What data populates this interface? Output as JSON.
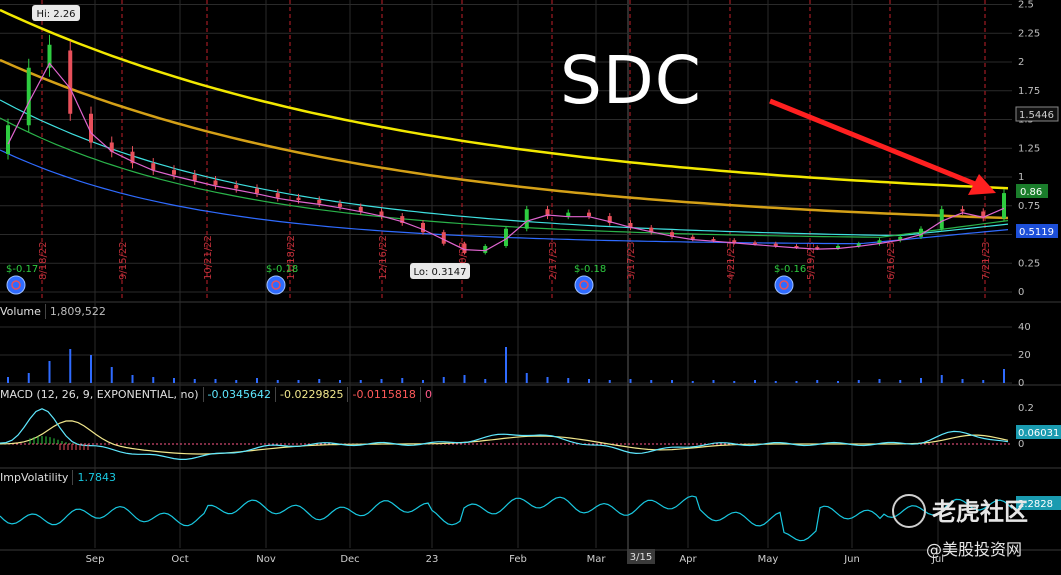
{
  "chart_title": "SDC",
  "colors": {
    "background": "#000000",
    "grid": "#2a2a2a",
    "candle_up": "#2ecc40",
    "candle_down": "#e8505b",
    "ma_yellow": "#f2e800",
    "ma_gold": "#d4a017",
    "ma_cyan": "#3fe0e0",
    "ma_green": "#2ab34a",
    "ma_blue": "#2f6bff",
    "ma_pink": "#e065d0",
    "ma_white": "#e8e8e8",
    "volume_bar": "#2f6bff",
    "macd_line": "#5fe8ff",
    "macd_signal": "#f0e68c",
    "macd_zero": "#ff5a8a",
    "iv_line": "#19c8e0",
    "arrow": "#ff2020"
  },
  "chart_data": [
    {
      "type": "candlestick",
      "pane": "price",
      "x_labels": [
        "Sep",
        "Oct",
        "Nov",
        "Dec",
        "23",
        "Feb",
        "Mar",
        "Apr",
        "May",
        "Jun",
        "Jul"
      ],
      "cursor_label": "3/15",
      "ylim": [
        0,
        2.5
      ],
      "y_ticks": [
        "2.5",
        "2.25",
        "2",
        "1.75",
        "1.5",
        "1.25",
        "1",
        "0.75",
        "0.5",
        "0.25",
        "0"
      ],
      "hi_label": "Hi: 2.26",
      "lo_label": "Lo: 0.3147",
      "last_price_label": "0.86",
      "level_labels": [
        "1.5446",
        "0.5119"
      ],
      "dividends": [
        "$-0.17",
        "$-0.18",
        "$-0.18",
        "$-0.16"
      ],
      "date_markers": [
        "8/18/22",
        "9/15/22",
        "10/21/22",
        "11/18/22",
        "12/16/22",
        "1/20/23",
        "2/17/23",
        "3/17/23",
        "4/21/23",
        "5/19/23",
        "6/16/23",
        "7/21/23"
      ],
      "candles_approx": [
        [
          1.2,
          1.45
        ],
        [
          1.45,
          1.95
        ],
        [
          1.95,
          2.15
        ],
        [
          2.1,
          1.55
        ],
        [
          1.55,
          1.3
        ],
        [
          1.3,
          1.22
        ],
        [
          1.22,
          1.12
        ],
        [
          1.12,
          1.06
        ],
        [
          1.06,
          1.02
        ],
        [
          1.02,
          0.97
        ],
        [
          0.97,
          0.93
        ],
        [
          0.93,
          0.9
        ],
        [
          0.9,
          0.86
        ],
        [
          0.86,
          0.82
        ],
        [
          0.82,
          0.8
        ],
        [
          0.8,
          0.77
        ],
        [
          0.77,
          0.74
        ],
        [
          0.74,
          0.7
        ],
        [
          0.7,
          0.66
        ],
        [
          0.66,
          0.6
        ],
        [
          0.6,
          0.52
        ],
        [
          0.52,
          0.42
        ],
        [
          0.42,
          0.34
        ],
        [
          0.34,
          0.4
        ],
        [
          0.4,
          0.55
        ],
        [
          0.55,
          0.72
        ],
        [
          0.72,
          0.66
        ],
        [
          0.66,
          0.69
        ],
        [
          0.69,
          0.66
        ],
        [
          0.66,
          0.6
        ],
        [
          0.6,
          0.56
        ],
        [
          0.56,
          0.52
        ],
        [
          0.52,
          0.48
        ],
        [
          0.48,
          0.46
        ],
        [
          0.46,
          0.45
        ],
        [
          0.45,
          0.43
        ],
        [
          0.43,
          0.42
        ],
        [
          0.42,
          0.4
        ],
        [
          0.4,
          0.39
        ],
        [
          0.39,
          0.38
        ],
        [
          0.38,
          0.4
        ],
        [
          0.4,
          0.42
        ],
        [
          0.42,
          0.45
        ],
        [
          0.45,
          0.48
        ],
        [
          0.48,
          0.55
        ],
        [
          0.55,
          0.72
        ],
        [
          0.72,
          0.7
        ],
        [
          0.7,
          0.64
        ],
        [
          0.64,
          0.86
        ]
      ]
    },
    {
      "type": "bar",
      "pane": "volume",
      "label": "Volume",
      "value_label": "1,809,522",
      "y_ticks": [
        "40",
        "20",
        "0"
      ],
      "ylim": [
        0,
        45
      ]
    },
    {
      "type": "line",
      "pane": "macd",
      "label": "MACD (12, 26, 9, EXPONENTIAL, no)",
      "values_shown": [
        "-0.0345642",
        "-0.0229825",
        "-0.0115818",
        "0"
      ],
      "y_ticks": [
        "0.2",
        "0"
      ],
      "last_value_label": "0.06031",
      "ylim": [
        -0.1,
        0.25
      ]
    },
    {
      "type": "line",
      "pane": "impvolatility",
      "label": "ImpVolatility",
      "value_label": "1.7843",
      "last_value_label": "2.2828"
    }
  ],
  "watermark": {
    "line1": "老虎社区",
    "line2": "@美股投资网"
  }
}
